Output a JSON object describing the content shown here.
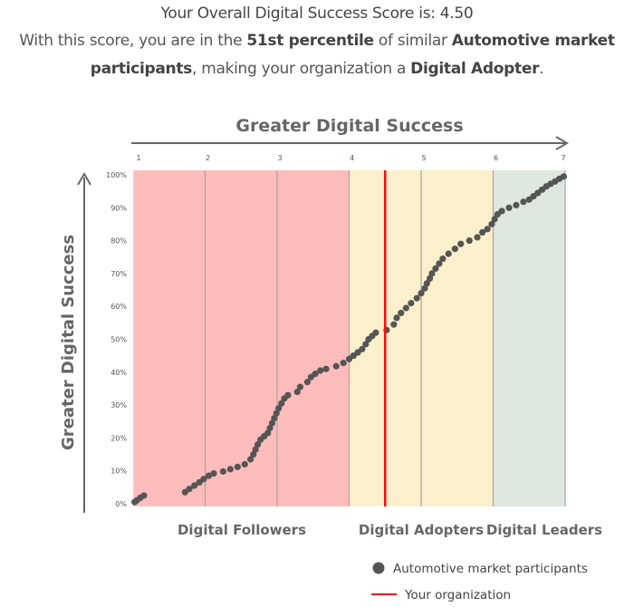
{
  "header": {
    "score_prefix": "Your Overall Digital Success Score is: ",
    "score_value": "4.50",
    "line2_a": "With this score, you are in the ",
    "line2_percentile": "51st percentile",
    "line2_b": " of similar ",
    "line2_market_a": "Automotive market",
    "line3_market_b": "participants",
    "line3_a": ", making your organization a ",
    "line3_category": "Digital Adopter",
    "line3_end": "."
  },
  "colors": {
    "followers_band": "#ffbcbc",
    "adopters_band": "#fbf0cc",
    "leaders_band": "#dfe8df",
    "points": "#555555",
    "your_org_line": "#ee1111",
    "grid": "#b0a8a0",
    "axis": "#666666"
  },
  "chart_data": {
    "type": "scatter",
    "title": "",
    "xlabel": "Greater Digital Success",
    "ylabel": "Greater Digital Success",
    "xlim": [
      1,
      7
    ],
    "ylim": [
      0,
      100
    ],
    "x_ticks": [
      "1",
      "2",
      "3",
      "4",
      "5",
      "6",
      "7"
    ],
    "y_ticks": [
      "0%",
      "10%",
      "20%",
      "30%",
      "40%",
      "50%",
      "60%",
      "70%",
      "80%",
      "90%",
      "100%"
    ],
    "grid": "vertical",
    "zones": [
      {
        "name": "Digital Followers",
        "from": 1,
        "to": 4
      },
      {
        "name": "Digital Adopters",
        "from": 4,
        "to": 6
      },
      {
        "name": "Digital Leaders",
        "from": 6,
        "to": 7
      }
    ],
    "your_organization": {
      "label": "Your organization",
      "score": 4.5,
      "percentile": 51
    },
    "legend": [
      {
        "label": "Automotive market participants",
        "marker": "circle"
      },
      {
        "label": "Your organization",
        "marker": "line"
      }
    ],
    "legend_position": "bottom-right",
    "series": [
      {
        "name": "Automotive market participants",
        "points": [
          [
            1.02,
            0.5
          ],
          [
            1.05,
            1.0
          ],
          [
            1.1,
            1.8
          ],
          [
            1.15,
            2.5
          ],
          [
            1.72,
            3.5
          ],
          [
            1.78,
            4.5
          ],
          [
            1.85,
            5.5
          ],
          [
            1.92,
            6.5
          ],
          [
            1.98,
            7.5
          ],
          [
            2.05,
            8.5
          ],
          [
            2.12,
            9.2
          ],
          [
            2.25,
            9.8
          ],
          [
            2.35,
            10.5
          ],
          [
            2.45,
            11.2
          ],
          [
            2.55,
            12.0
          ],
          [
            2.63,
            13.5
          ],
          [
            2.67,
            15.0
          ],
          [
            2.7,
            16.5
          ],
          [
            2.73,
            18.0
          ],
          [
            2.77,
            19.5
          ],
          [
            2.82,
            20.5
          ],
          [
            2.87,
            21.5
          ],
          [
            2.9,
            23.0
          ],
          [
            2.93,
            24.5
          ],
          [
            2.96,
            26.0
          ],
          [
            2.99,
            27.5
          ],
          [
            3.02,
            29.0
          ],
          [
            3.06,
            30.5
          ],
          [
            3.1,
            32.0
          ],
          [
            3.15,
            33.0
          ],
          [
            3.28,
            34.0
          ],
          [
            3.32,
            35.5
          ],
          [
            3.42,
            37.0
          ],
          [
            3.47,
            38.5
          ],
          [
            3.53,
            39.5
          ],
          [
            3.6,
            40.5
          ],
          [
            3.68,
            41.0
          ],
          [
            3.82,
            41.8
          ],
          [
            3.92,
            42.8
          ],
          [
            4.0,
            44.0
          ],
          [
            4.06,
            45.0
          ],
          [
            4.12,
            46.0
          ],
          [
            4.18,
            47.0
          ],
          [
            4.23,
            48.5
          ],
          [
            4.27,
            50.0
          ],
          [
            4.32,
            51.0
          ],
          [
            4.37,
            52.0
          ],
          [
            4.52,
            52.8
          ],
          [
            4.62,
            54.5
          ],
          [
            4.66,
            56.5
          ],
          [
            4.72,
            58.0
          ],
          [
            4.79,
            59.5
          ],
          [
            4.86,
            61.0
          ],
          [
            4.94,
            62.5
          ],
          [
            5.0,
            64.0
          ],
          [
            5.05,
            65.5
          ],
          [
            5.08,
            67.0
          ],
          [
            5.12,
            68.5
          ],
          [
            5.15,
            70.0
          ],
          [
            5.2,
            71.5
          ],
          [
            5.25,
            73.0
          ],
          [
            5.3,
            74.5
          ],
          [
            5.38,
            76.0
          ],
          [
            5.47,
            77.5
          ],
          [
            5.55,
            79.0
          ],
          [
            5.67,
            80.0
          ],
          [
            5.78,
            81.0
          ],
          [
            5.85,
            82.5
          ],
          [
            5.92,
            83.5
          ],
          [
            5.98,
            85.0
          ],
          [
            6.02,
            86.5
          ],
          [
            6.06,
            88.0
          ],
          [
            6.12,
            89.0
          ],
          [
            6.22,
            90.0
          ],
          [
            6.32,
            90.8
          ],
          [
            6.42,
            91.8
          ],
          [
            6.5,
            92.5
          ],
          [
            6.56,
            93.5
          ],
          [
            6.62,
            94.5
          ],
          [
            6.68,
            95.5
          ],
          [
            6.74,
            96.5
          ],
          [
            6.8,
            97.3
          ],
          [
            6.86,
            98.0
          ],
          [
            6.92,
            98.8
          ],
          [
            6.98,
            99.5
          ]
        ]
      }
    ]
  }
}
